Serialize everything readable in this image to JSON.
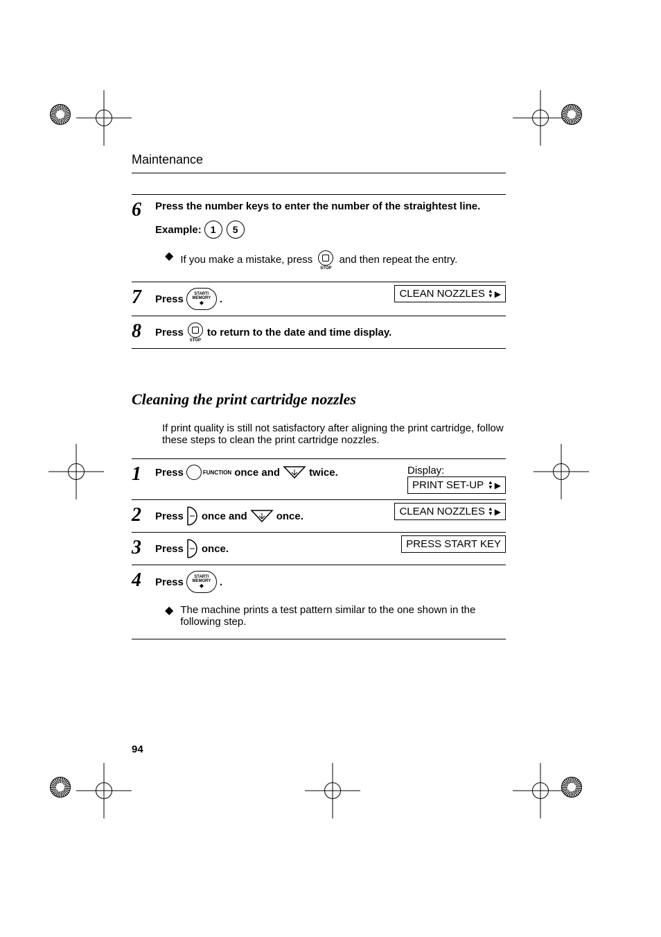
{
  "header": "Maintenance",
  "page_number": "94",
  "s6": {
    "instruction_a": "Press the number keys to enter the number of the straightest line.",
    "example_label": "Example:",
    "key1": "1",
    "key5": "5",
    "bullet_a": "If you make a mistake, press ",
    "bullet_b": " and then repeat the entry."
  },
  "s7": {
    "press": "Press ",
    "period": ".",
    "start_l1": "START/",
    "start_l2": "MEMORY",
    "lcd": "CLEAN NOZZLES"
  },
  "s8": {
    "press": "Press ",
    "rest": " to return to the date and time display."
  },
  "stop_label": "STOP",
  "section_title": "Cleaning the print cartridge nozzles",
  "intro": "If print quality is still not satisfactory after aligning the print cartridge, follow these steps to clean the print cartridge nozzles.",
  "c1": {
    "press": "Press ",
    "func": "FUNCTION",
    "mid": " once and ",
    "end": " twice.",
    "disp_label": "Display:",
    "lcd": "PRINT SET-UP"
  },
  "c2": {
    "press": "Press ",
    "mid": " once and ",
    "end": " once.",
    "lcd": "CLEAN NOZZLES"
  },
  "c3": {
    "press": "Press ",
    "end": " once.",
    "lcd": "PRESS START KEY"
  },
  "c4": {
    "press": "Press ",
    "period": ".",
    "start_l1": "START/",
    "start_l2": "MEMORY",
    "bullet": "The machine prints a test pattern similar to the one shown in the following step."
  },
  "nums": {
    "n6": "6",
    "n7": "7",
    "n8": "8",
    "n1": "1",
    "n2": "2",
    "n3": "3",
    "n4": "4"
  }
}
